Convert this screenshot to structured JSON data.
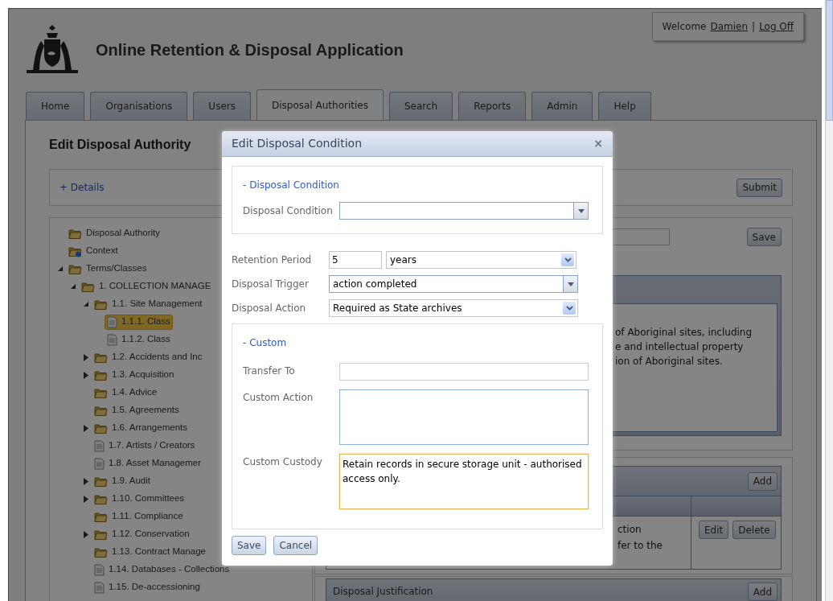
{
  "header": {
    "title": "Online Retention & Disposal Application"
  },
  "user_box": {
    "welcome": "Welcome",
    "user": "Damien",
    "separator": "|",
    "logoff": "Log Off"
  },
  "tabs": [
    {
      "label": "Home",
      "selected": false
    },
    {
      "label": "Organisations",
      "selected": false
    },
    {
      "label": "Users",
      "selected": false
    },
    {
      "label": "Disposal Authorities",
      "selected": true
    },
    {
      "label": "Search",
      "selected": false
    },
    {
      "label": "Reports",
      "selected": false
    },
    {
      "label": "Admin",
      "selected": false
    },
    {
      "label": "Help",
      "selected": false
    }
  ],
  "page": {
    "title": "Edit Disposal Authority",
    "details_link": "+ Details",
    "submit": "Submit",
    "save": "Save",
    "description_lines": [
      "of Aboriginal sites, including",
      "e and intellectual property",
      "ion of Aboriginal sites."
    ],
    "conditions_panel": {
      "add": "Add",
      "row_lines": [
        "ction",
        "fer to the"
      ],
      "edit": "Edit",
      "delete": "Delete"
    },
    "justification_panel": {
      "title": "Disposal Justification",
      "add": "Add"
    }
  },
  "tree": [
    {
      "kind": "folder",
      "label": "Disposal Authority",
      "selected": false
    },
    {
      "kind": "info-folder",
      "label": "Context",
      "selected": false
    },
    {
      "kind": "folder",
      "label": "Terms/Classes",
      "selected": false,
      "expanded": true,
      "children": [
        {
          "kind": "folder",
          "label": "1. COLLECTION MANAGE",
          "selected": false,
          "expanded": true,
          "children": [
            {
              "kind": "folder",
              "label": "1.1. Site Management",
              "selected": false,
              "expanded": true,
              "children": [
                {
                  "kind": "document",
                  "label": "1.1.1. Class",
                  "selected": true
                },
                {
                  "kind": "document",
                  "label": "1.1.2. Class",
                  "selected": false
                }
              ]
            },
            {
              "kind": "folder",
              "label": "1.2. Accidents and Inc",
              "selected": false,
              "expanded": false
            },
            {
              "kind": "folder",
              "label": "1.3. Acquisition",
              "selected": false,
              "expanded": false
            },
            {
              "kind": "folder",
              "label": "1.4. Advice",
              "selected": false
            },
            {
              "kind": "folder",
              "label": "1.5. Agreements",
              "selected": false
            },
            {
              "kind": "folder",
              "label": "1.6. Arrangements",
              "selected": false,
              "expanded": false
            },
            {
              "kind": "document",
              "label": "1.7. Artists / Creators",
              "selected": false
            },
            {
              "kind": "document",
              "label": "1.8. Asset Managemer",
              "selected": false
            },
            {
              "kind": "folder",
              "label": "1.9. Audit",
              "selected": false,
              "expanded": false
            },
            {
              "kind": "folder",
              "label": "1.10. Committees",
              "selected": false,
              "expanded": false
            },
            {
              "kind": "folder",
              "label": "1.11. Compliance",
              "selected": false
            },
            {
              "kind": "folder",
              "label": "1.12. Conservation",
              "selected": false,
              "expanded": false
            },
            {
              "kind": "folder",
              "label": "1.13. Contract Manage",
              "selected": false
            },
            {
              "kind": "document",
              "label": "1.14. Databases - Collections",
              "selected": false
            },
            {
              "kind": "document",
              "label": "1.15. De-accessioning",
              "selected": false
            }
          ]
        }
      ]
    }
  ],
  "dialog": {
    "title": "Edit Disposal Condition",
    "close": "×",
    "condition_section": {
      "legend": "- Disposal Condition",
      "label": "Disposal Condition"
    },
    "fields": [
      {
        "kind": "number-unit",
        "label": "Retention Period",
        "value": "5",
        "unit": "years"
      },
      {
        "kind": "combo",
        "label": "Disposal Trigger",
        "value": "action completed"
      },
      {
        "kind": "select",
        "label": "Disposal Action",
        "value": "Required as State archives"
      }
    ],
    "custom_section": {
      "legend": "- Custom",
      "fields": [
        {
          "kind": "input",
          "label": "Transfer To"
        },
        {
          "kind": "textarea",
          "label": "Custom Action",
          "focused": false
        },
        {
          "kind": "textarea",
          "label": "Custom Custody",
          "value": "Retain records in secure storage unit - authorised access only.",
          "focused": true
        }
      ]
    },
    "buttons": [
      "Save",
      "Cancel"
    ]
  }
}
